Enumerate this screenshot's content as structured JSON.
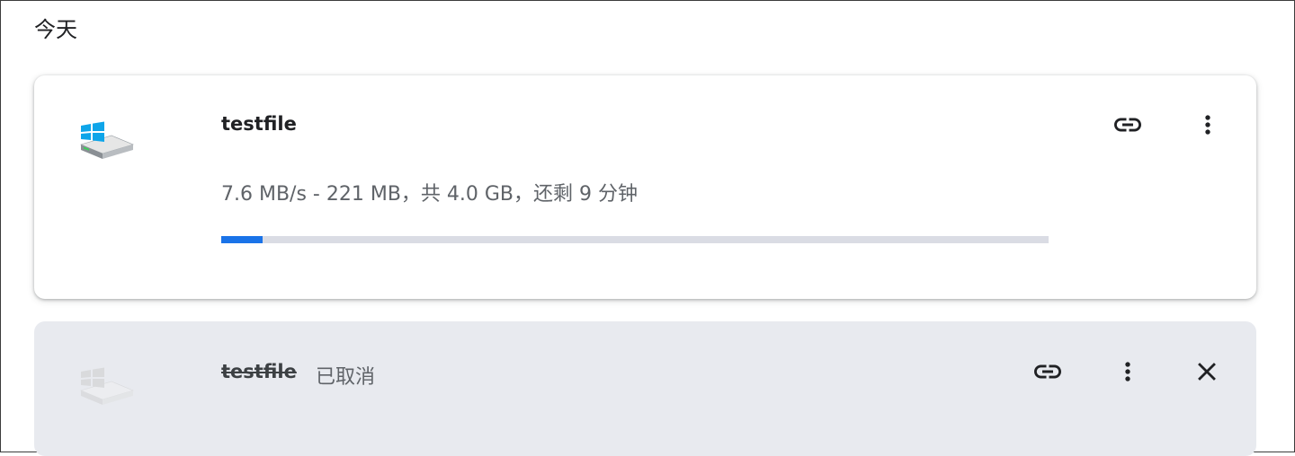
{
  "section": {
    "title": "今天"
  },
  "downloads": [
    {
      "filename": "testfile",
      "status_line": "7.6 MB/s - 221 MB，共 4.0 GB，还剩 9 分钟",
      "progress_fraction": 0.05,
      "icon": "drive-icon",
      "actions": [
        "link-icon",
        "more-vert-icon"
      ]
    },
    {
      "filename": "testfile",
      "status": "已取消",
      "icon": "drive-icon",
      "actions": [
        "link-icon",
        "more-vert-icon",
        "close-icon"
      ]
    }
  ],
  "colors": {
    "accent": "#1a73e8",
    "track": "#dadce4",
    "cancelled_bg": "#e8eaef",
    "secondary_text": "#5f6368"
  }
}
